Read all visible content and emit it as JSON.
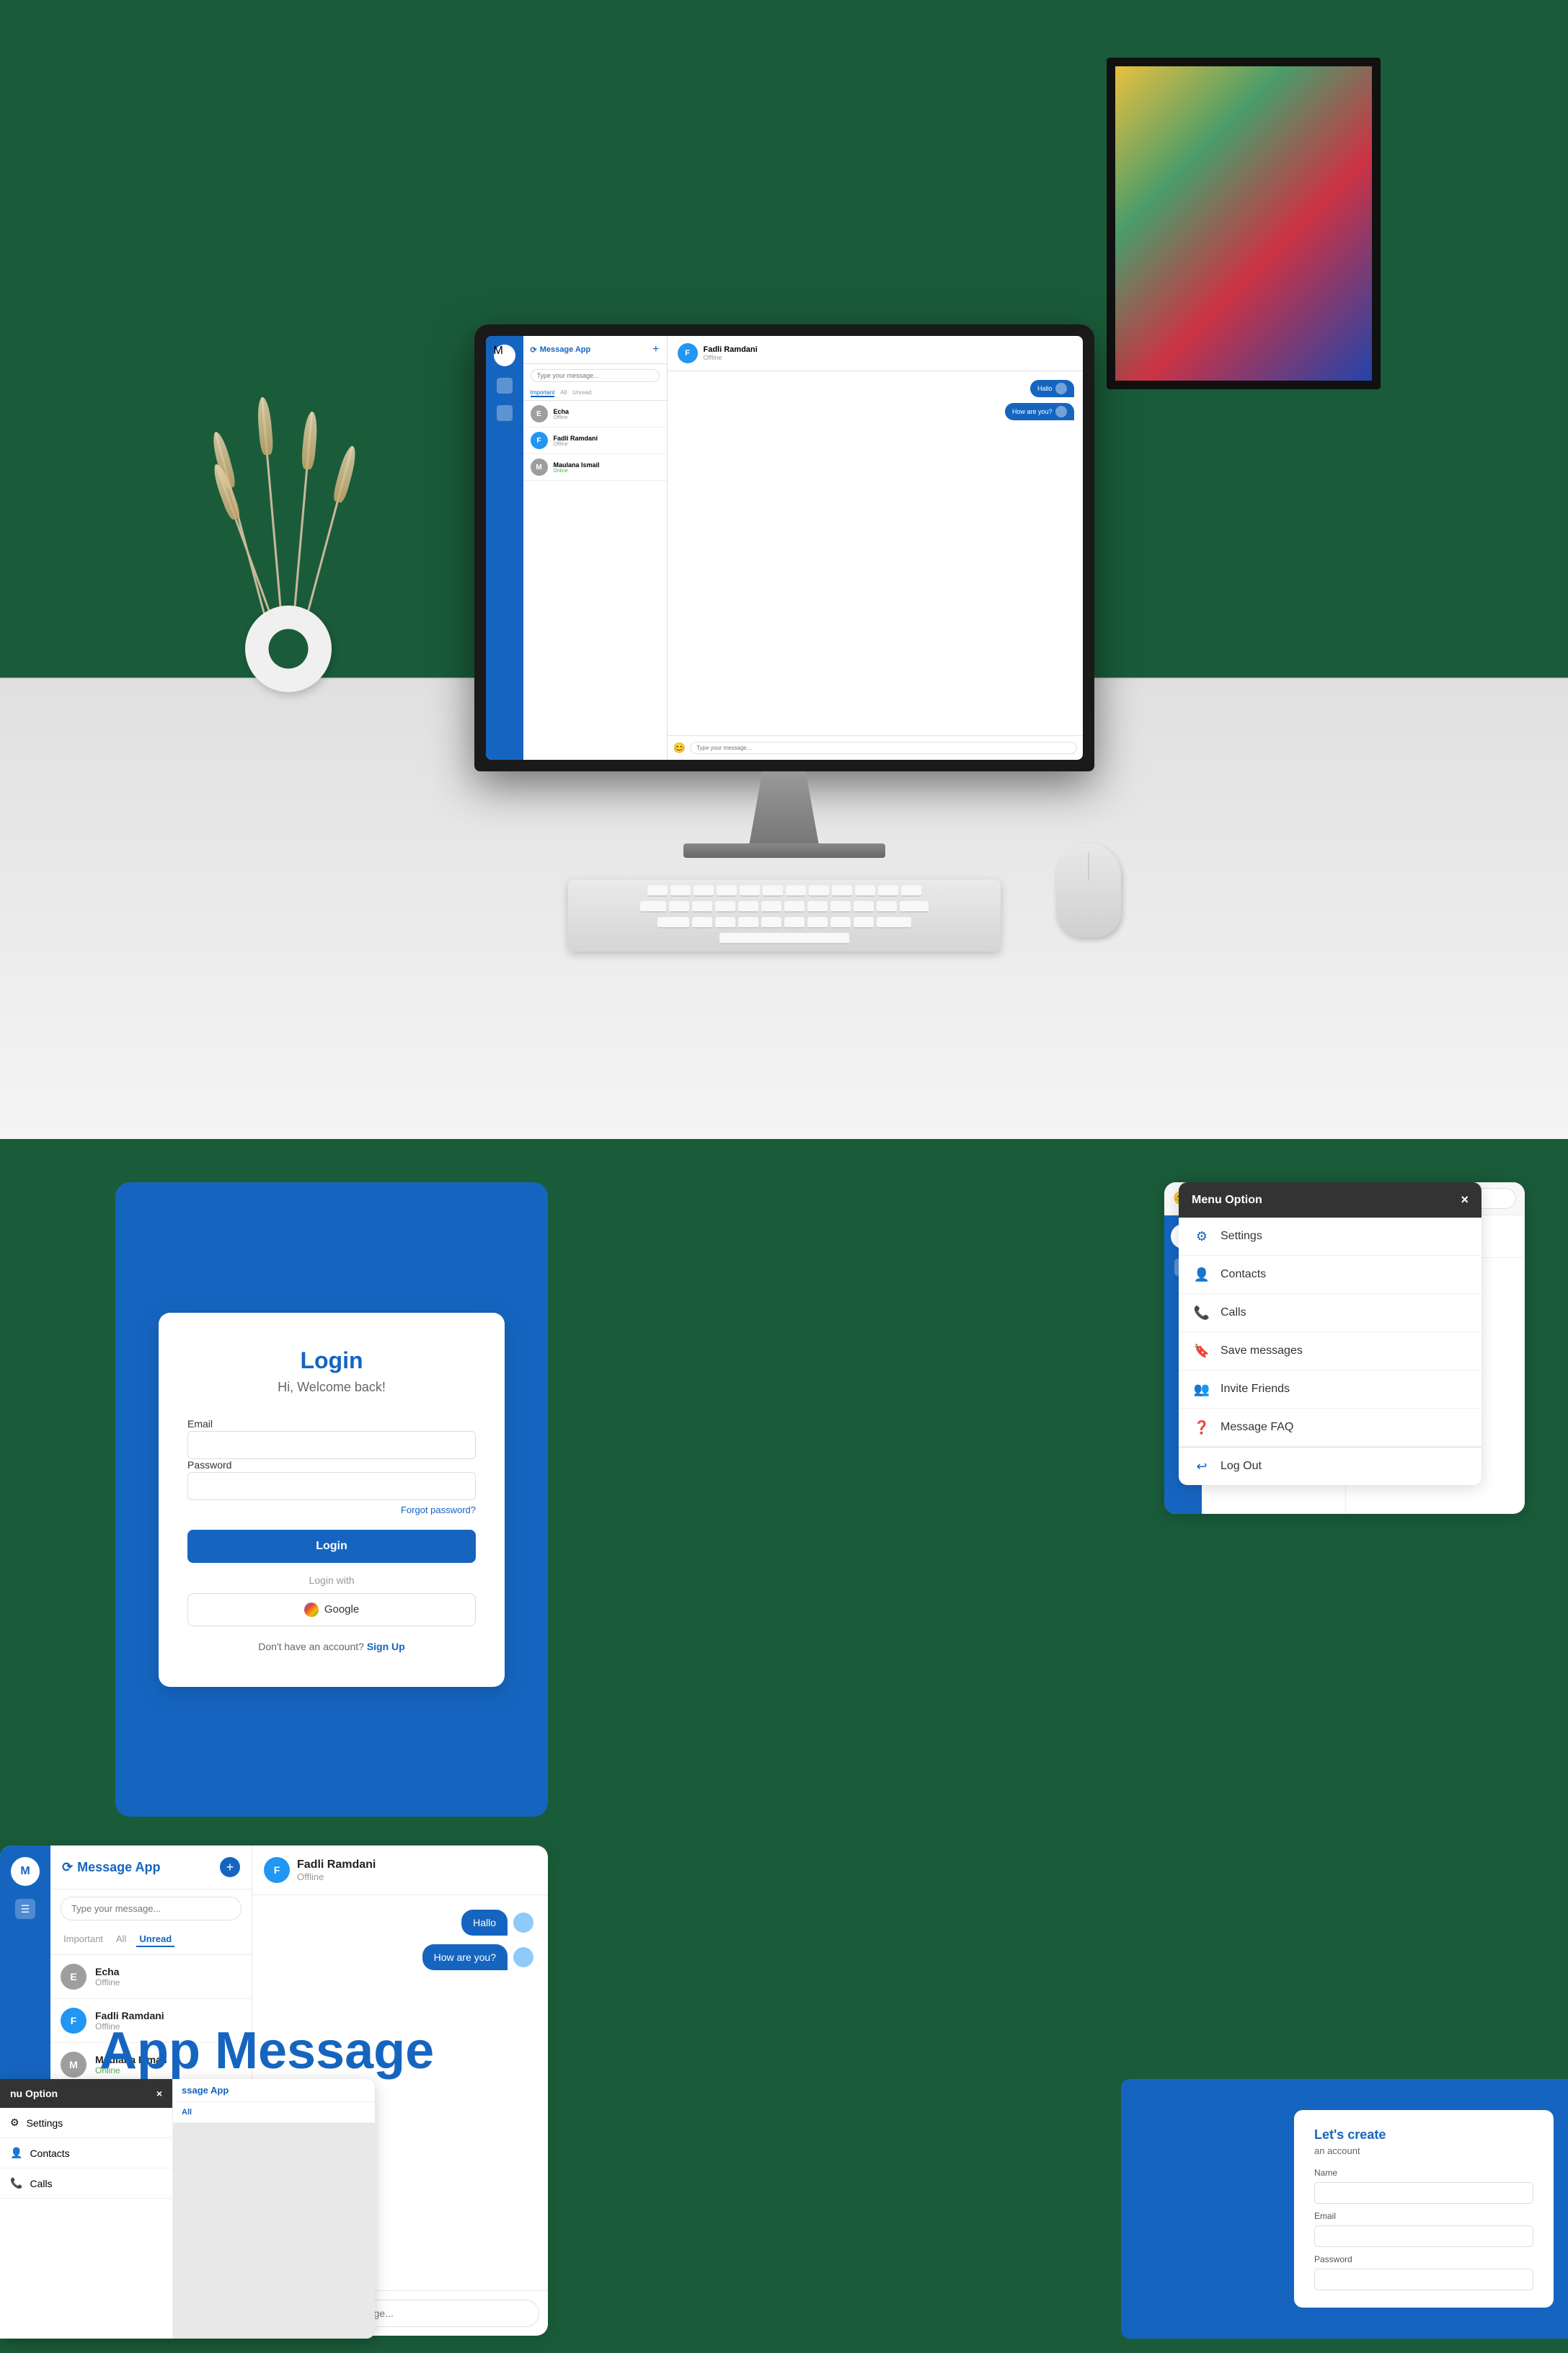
{
  "app": {
    "name": "Message App",
    "tagline": "App Message"
  },
  "desk_scene": {
    "has_keyboard": true,
    "has_mouse": true,
    "has_vase": true,
    "has_picture": true
  },
  "monitor_app": {
    "sidebar_icons": [
      "M",
      "☰"
    ],
    "contact_list_header": "Message App",
    "search_placeholder": "Type your message...",
    "tabs": [
      "Important",
      "All",
      "Unread"
    ],
    "contacts": [
      {
        "initial": "E",
        "name": "Echa",
        "status": "Offline",
        "color": "#9e9e9e"
      },
      {
        "initial": "F",
        "name": "Fadli Ramdani",
        "status": "Offline",
        "color": "#2196f3"
      },
      {
        "initial": "M",
        "name": "Maulana Ismail",
        "status": "Online",
        "color": "#9e9e9e"
      }
    ],
    "active_chat": {
      "name": "Fadli Ramdani",
      "status": "Offline",
      "messages": [
        "Hallo",
        "How are you?"
      ]
    },
    "input_placeholder": "Type your message..."
  },
  "login": {
    "title": "Login",
    "subtitle": "Hi, Welcome back!",
    "email_label": "Email",
    "email_placeholder": "",
    "password_label": "Password",
    "password_placeholder": "",
    "forgot_password": "Forgot password?",
    "login_button": "Login",
    "login_with": "Login with",
    "google_button": "Google",
    "signup_text": "Don't have an account?",
    "signup_link": "Sign Up"
  },
  "menu_option": {
    "title": "Menu Option",
    "close_btn": "×",
    "items": [
      {
        "icon": "⚙",
        "label": "Settings"
      },
      {
        "icon": "👤",
        "label": "Contacts"
      },
      {
        "icon": "📞",
        "label": "Calls"
      },
      {
        "icon": "🔖",
        "label": "Save messages"
      },
      {
        "icon": "👥",
        "label": "Invite Friends"
      },
      {
        "icon": "❓",
        "label": "Message FAQ"
      }
    ],
    "logout": "Log Out"
  },
  "chat_app": {
    "title": "Message App",
    "search_placeholder": "Type your message...",
    "tabs": [
      {
        "label": "Important",
        "active": false
      },
      {
        "label": "All",
        "active": false
      },
      {
        "label": "Unread",
        "active": true
      }
    ],
    "contacts": [
      {
        "initial": "E",
        "name": "Echa",
        "status": "Offline",
        "color": "#9e9e9e"
      },
      {
        "initial": "F",
        "name": "Fadli Ramdani",
        "status": "Offline",
        "color": "#2196f3"
      },
      {
        "initial": "M",
        "name": "Maulana Ismail",
        "status": "Online",
        "color": "#9e9e9e"
      }
    ],
    "active_chat": {
      "name": "Fadli Ramdani",
      "status": "Offline",
      "messages": [
        "Hallo",
        "How are you?"
      ]
    },
    "input_placeholder": "Type your message..."
  },
  "register": {
    "title": "Let's create",
    "subtitle": "an account",
    "name_label": "Name",
    "email_label": "Email",
    "password_label": "Password"
  },
  "bottom_app": {
    "menu_item_1": "nu Option",
    "menu_item_2": "Settings",
    "menu_item_3": "Contacts",
    "menu_item_4": "ssage App",
    "sidebar_items": [
      "M"
    ],
    "tabs": [
      "All"
    ]
  }
}
